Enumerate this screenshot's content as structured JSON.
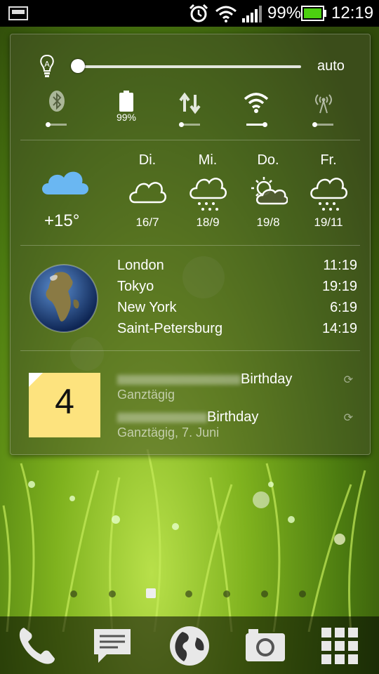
{
  "status_bar": {
    "battery_percent": "99%",
    "time": "12:19",
    "icons": [
      "screenshot-icon",
      "alarm-icon",
      "wifi-icon",
      "signal-icon",
      "battery-icon"
    ]
  },
  "widget": {
    "brightness": {
      "label": "auto",
      "level": 0.0
    },
    "toggles": [
      {
        "name": "bluetooth-icon",
        "state": "off"
      },
      {
        "name": "battery-icon",
        "label": "99%"
      },
      {
        "name": "data-sync-icon",
        "state": "off"
      },
      {
        "name": "wifi-icon",
        "state": "on"
      },
      {
        "name": "hotspot-icon",
        "state": "off"
      }
    ],
    "weather": {
      "current_temp": "+15°",
      "current_icon": "cloud-icon",
      "days": [
        {
          "name": "Di.",
          "icon": "cloud-icon",
          "temps": "16/7"
        },
        {
          "name": "Mi.",
          "icon": "rain-icon",
          "temps": "18/9"
        },
        {
          "name": "Do.",
          "icon": "partly-sunny-icon",
          "temps": "19/8"
        },
        {
          "name": "Fr.",
          "icon": "rain-icon",
          "temps": "19/11"
        }
      ]
    },
    "clocks": [
      {
        "city": "London",
        "time": "11:19"
      },
      {
        "city": "Tokyo",
        "time": "19:19"
      },
      {
        "city": "New York",
        "time": "6:19"
      },
      {
        "city": "Saint-Petersburg",
        "time": "14:19"
      }
    ],
    "calendar": {
      "day": "4",
      "events": [
        {
          "title": "Birthday",
          "sub": "Ganztägig"
        },
        {
          "title": "Birthday",
          "sub": "Ganztägig, 7. Juni"
        }
      ]
    }
  },
  "dock": [
    "phone-icon",
    "messages-icon",
    "browser-icon",
    "camera-icon",
    "all-apps-icon"
  ]
}
